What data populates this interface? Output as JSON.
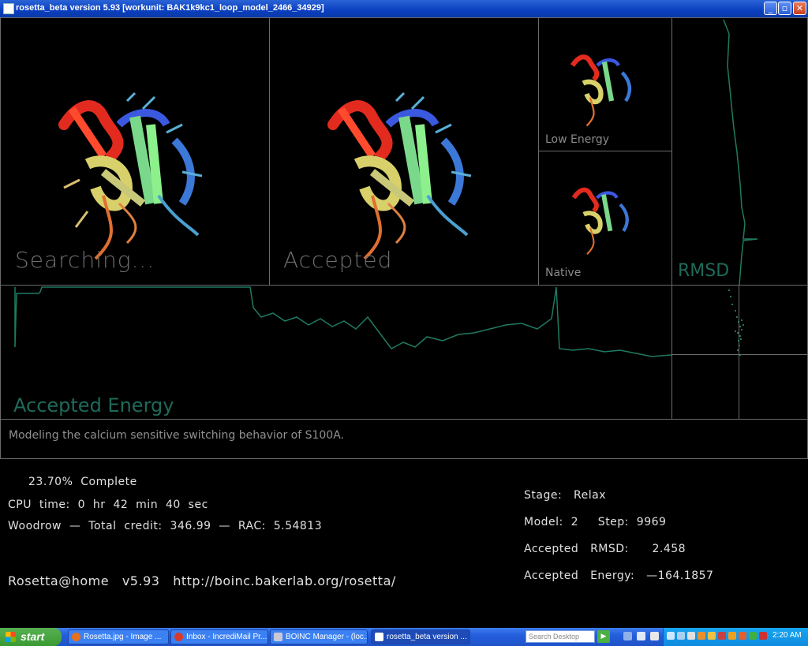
{
  "window": {
    "title": "rosetta_beta version 5.93 [workunit: BAK1k9kc1_loop_model_2466_34929]",
    "controls": [
      "minimize",
      "maximize",
      "close"
    ]
  },
  "panels": {
    "searching_label": "Searching...",
    "accepted_label": "Accepted",
    "low_energy_label": "Low  Energy",
    "native_label": "Native",
    "rmsd_label": "RMSD",
    "accepted_energy_label": "Accepted  Energy"
  },
  "description": "Modeling   the   calcium   sensitive   switching   behavior   of   S100A.",
  "status": {
    "percent_complete": "23.70%  Complete",
    "cpu_time": "CPU  time:  0  hr  42  min  40  sec",
    "credit": "Woodrow  —  Total  credit:  346.99  —  RAC:  5.54813",
    "project": "Rosetta@home   v5.93   http://boinc.bakerlab.org/rosetta/",
    "stage": "Stage:   Relax",
    "model_step": "Model:  2     Step:  9969",
    "accepted_rmsd": "Accepted   RMSD:      2.458",
    "accepted_energy": "Accepted   Energy:   —164.1857"
  },
  "colors": {
    "trace": "#1f7a62",
    "panel_border": "#6b6b6b",
    "helix_red": "#e22b1e",
    "helix_green": "#8cf08c",
    "helix_blue": "#3060e0"
  },
  "taskbar": {
    "start_label": "start",
    "tasks": [
      {
        "label": "Rosetta.jpg - Image ...",
        "icon": "firefox-icon"
      },
      {
        "label": "Inbox - IncrediMail Pr...",
        "icon": "incredimail-icon"
      },
      {
        "label": "BOINC Manager - (loc...",
        "icon": "boinc-icon"
      },
      {
        "label": "rosetta_beta version ...",
        "icon": "rosetta-window-icon"
      }
    ],
    "search_placeholder": "Search Desktop",
    "clock": "2:20 AM"
  }
}
